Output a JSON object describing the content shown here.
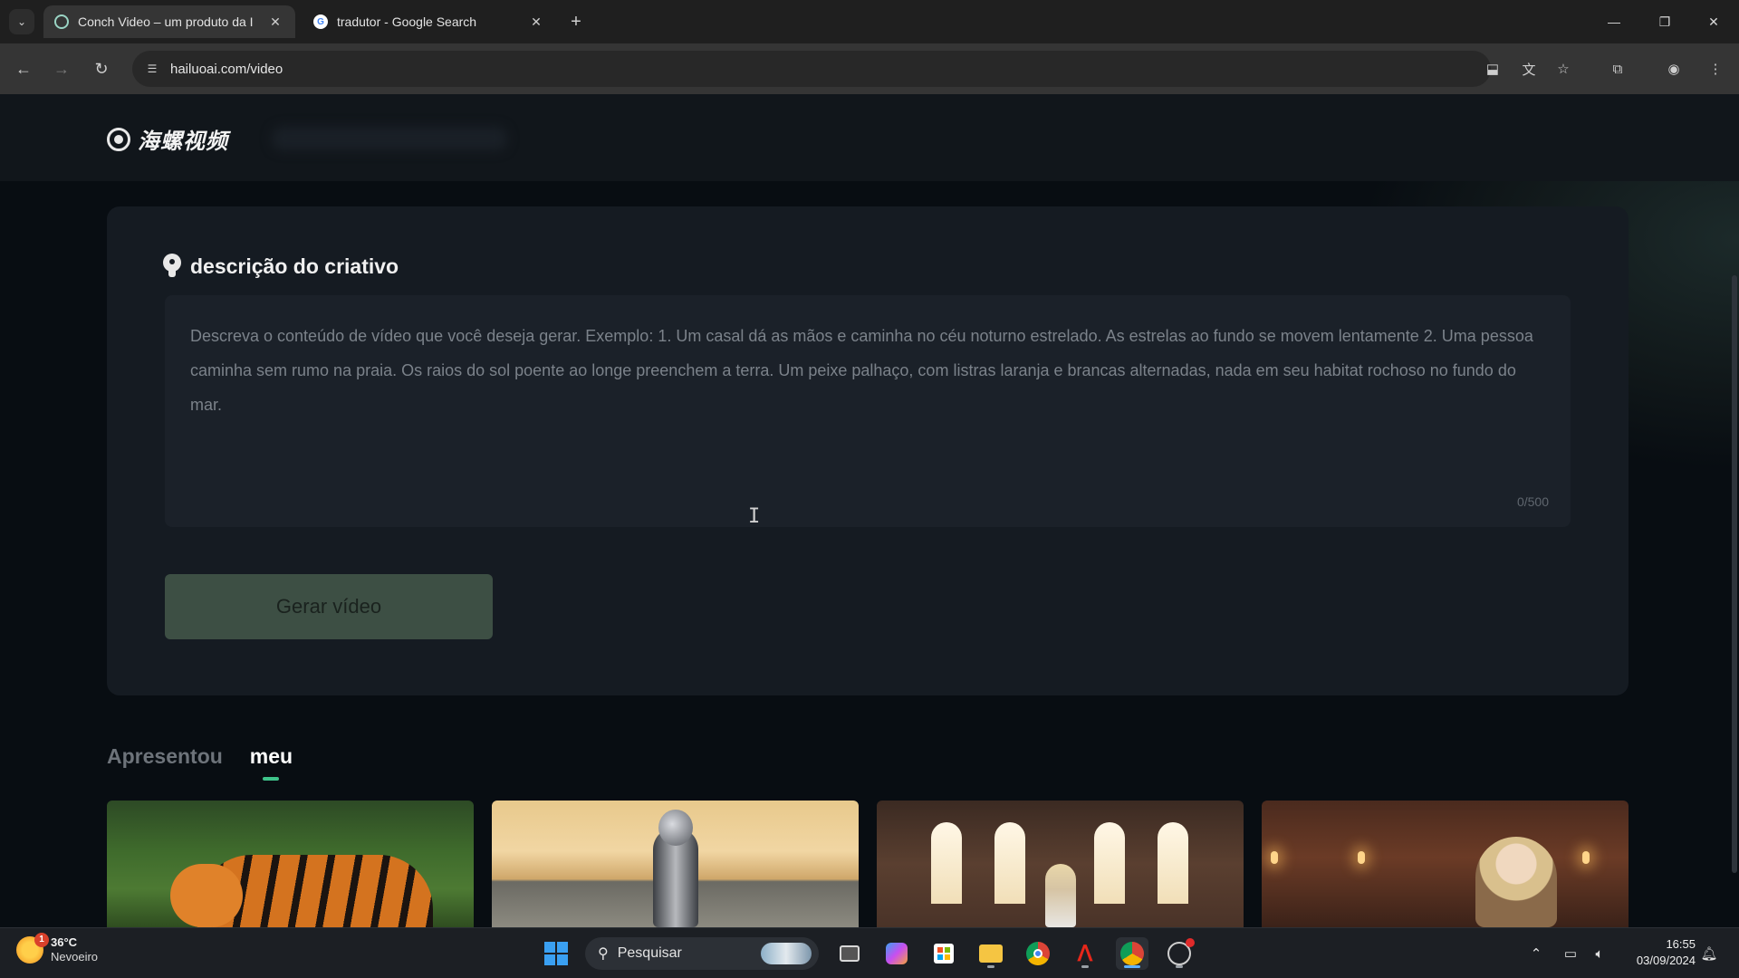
{
  "browser": {
    "tabs": [
      {
        "title": "Conch Video – um produto da I",
        "active": true
      },
      {
        "title": "tradutor - Google Search",
        "active": false
      }
    ],
    "url": "hailuoai.com/video"
  },
  "site": {
    "logo_text": "海螺视频"
  },
  "creative": {
    "heading": "descrição do criativo",
    "placeholder": "Descreva o conteúdo de vídeo que você deseja gerar. Exemplo: 1. Um casal dá as mãos e caminha no céu noturno estrelado. As estrelas ao fundo se movem lentamente 2. Uma pessoa caminha sem rumo na praia. Os raios do sol poente ao longe preenchem a terra. Um peixe palhaço, com listras laranja e brancas alternadas, nada em seu habitat rochoso no fundo do mar.",
    "counter": "0/500",
    "generate_label": "Gerar vídeo"
  },
  "gallery_tabs": [
    {
      "label": "Apresentou",
      "active": false
    },
    {
      "label": "meu",
      "active": true
    }
  ],
  "taskbar": {
    "weather_temp": "36°C",
    "weather_cond": "Nevoeiro",
    "weather_badge": "1",
    "search_label": "Pesquisar",
    "time": "16:55",
    "date": "03/09/2024"
  },
  "colors": {
    "accent_green": "#3ec38a",
    "button_bg": "#3d4f44",
    "panel_bg": "#151b22"
  }
}
